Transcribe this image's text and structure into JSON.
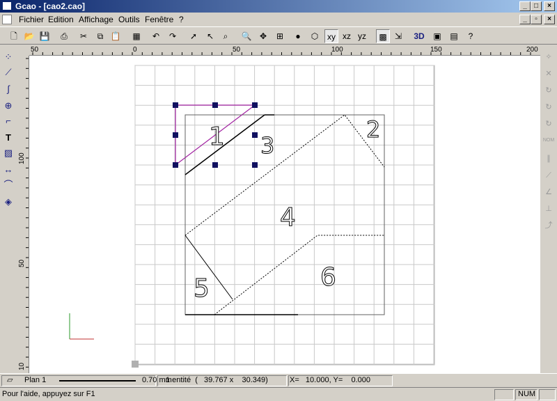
{
  "window": {
    "title": "Gcao - [cao2.cao]"
  },
  "menu": {
    "items": [
      {
        "label": "Fichier"
      },
      {
        "label": "Edition"
      },
      {
        "label": "Affichage"
      },
      {
        "label": "Outils"
      },
      {
        "label": "Fenêtre"
      },
      {
        "label": "?"
      }
    ]
  },
  "toolbar": {
    "view_3d_label": "3D"
  },
  "ruler": {
    "h_labels": [
      "50",
      "0",
      "50",
      "100",
      "150",
      "200"
    ],
    "v_labels": [
      "100",
      "50",
      "10"
    ]
  },
  "drawing": {
    "labels": [
      "1",
      "2",
      "3",
      "4",
      "5",
      "6"
    ],
    "accent_color": "#a020a0",
    "handle_color": "#101060"
  },
  "status": {
    "layer": "Plan 1",
    "line_width": "0.70 mm",
    "selection": "1 entité  (   39.767 x    30.349)",
    "coords": "X=   10.000, Y=    0.000",
    "help": "Pour l'aide, appuyez sur F1",
    "num": "NUM"
  }
}
